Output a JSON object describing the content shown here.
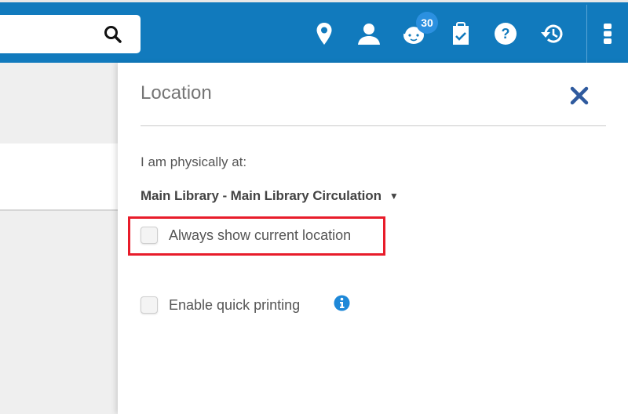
{
  "header": {
    "search": {
      "placeholder": "",
      "value": ""
    },
    "icons": [
      {
        "name": "location-pin-icon",
        "label": "Location"
      },
      {
        "name": "user-icon",
        "label": "User"
      },
      {
        "name": "baby-face-icon",
        "label": "Notifications",
        "badge": "30"
      },
      {
        "name": "clipboard-check-icon",
        "label": "Tasks"
      },
      {
        "name": "help-icon",
        "label": "Help"
      },
      {
        "name": "history-icon",
        "label": "History"
      },
      {
        "name": "more-vertical-icon",
        "label": "More"
      }
    ],
    "badge_count": "30",
    "colors": {
      "bar": "#117abd",
      "badge": "#2b90e0"
    }
  },
  "panel": {
    "title": "Location",
    "physically_at_label": "I am physically at:",
    "location_value": "Main Library - Main Library Circulation",
    "caret": "▼",
    "always_show_label": "Always show current location",
    "always_show_checked": false,
    "quick_print_label": "Enable quick printing",
    "quick_print_checked": false,
    "highlight_color": "#e81c2a",
    "close_color": "#2f5a9e"
  }
}
